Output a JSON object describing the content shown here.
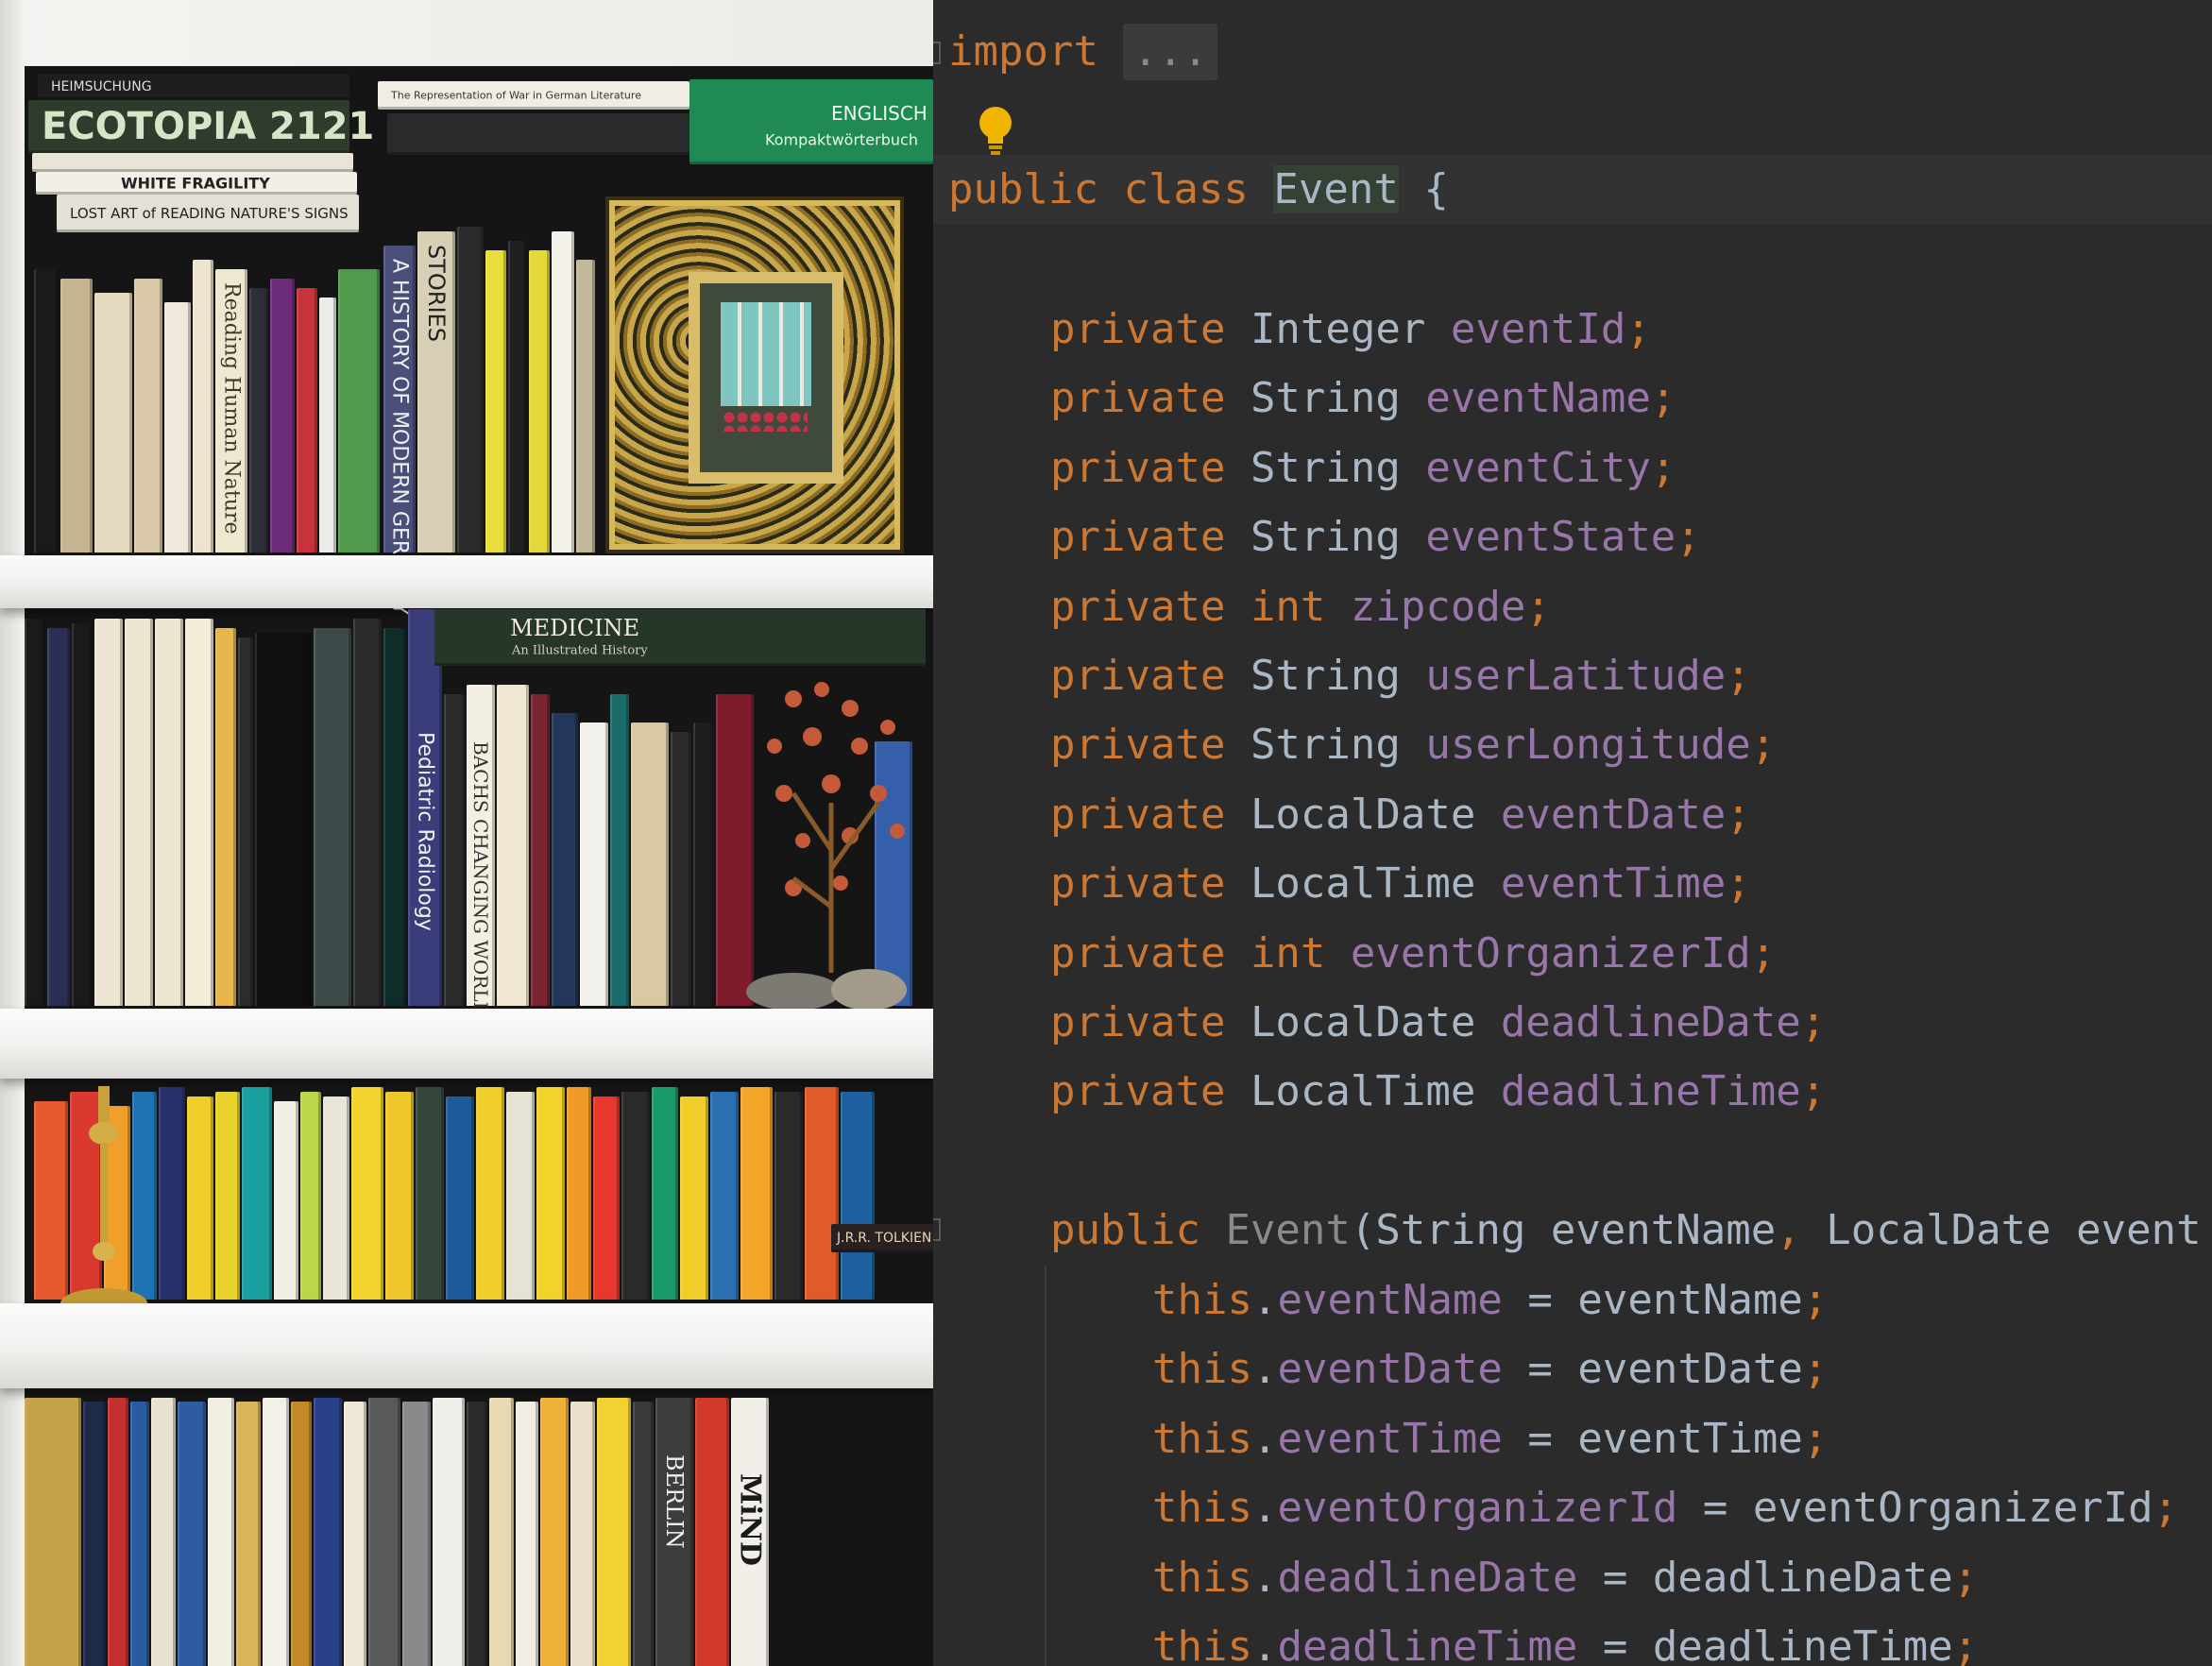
{
  "photo": {
    "book_titles": [
      "ECOTOPIA 2121",
      "WHITE FRAGILITY",
      "LOST ART of READING NATURE'S SIGNS",
      "STORIES",
      "A HISTORY OF MODERN GERMANY",
      "MEDICINE",
      "An Illustrated History",
      "Pediatric Radiology",
      "BACHS CHANGING WORLD",
      "BERLIN",
      "MiND",
      "ENGLISCH",
      "Kompaktwörterbuch",
      "HEIMSUCHUNG",
      "Reading Human Nature",
      "J.R.R. TOLKIEN",
      "The Representation of War in German Literature"
    ],
    "colors": {
      "wall": "#f4f3f0",
      "shelf": "#f1f0ee",
      "frame_gold": "#d8b95a"
    }
  },
  "editor": {
    "theme": {
      "background": "#2b2b2b",
      "keyword": "#cc7832",
      "field": "#9876aa",
      "text": "#a9b7c6",
      "ctor": "#8a8a8a",
      "bulb": "#f0b400"
    },
    "import_kw": "import",
    "import_fold": "...",
    "class_decl": {
      "kw1": "public",
      "kw2": "class",
      "name": "Event",
      "brace": "{"
    },
    "fields": [
      {
        "mod": "private",
        "type": "Integer",
        "name": "eventId",
        "primitive": false
      },
      {
        "mod": "private",
        "type": "String",
        "name": "eventName",
        "primitive": false
      },
      {
        "mod": "private",
        "type": "String",
        "name": "eventCity",
        "primitive": false
      },
      {
        "mod": "private",
        "type": "String",
        "name": "eventState",
        "primitive": false
      },
      {
        "mod": "private",
        "type": "int",
        "name": "zipcode",
        "primitive": true
      },
      {
        "mod": "private",
        "type": "String",
        "name": "userLatitude",
        "primitive": false
      },
      {
        "mod": "private",
        "type": "String",
        "name": "userLongitude",
        "primitive": false
      },
      {
        "mod": "private",
        "type": "LocalDate",
        "name": "eventDate",
        "primitive": false
      },
      {
        "mod": "private",
        "type": "LocalTime",
        "name": "eventTime",
        "primitive": false
      },
      {
        "mod": "private",
        "type": "int",
        "name": "eventOrganizerId",
        "primitive": true
      },
      {
        "mod": "private",
        "type": "LocalDate",
        "name": "deadlineDate",
        "primitive": false
      },
      {
        "mod": "private",
        "type": "LocalTime",
        "name": "deadlineTime",
        "primitive": false
      }
    ],
    "constructor": {
      "kw": "public",
      "name": "Event",
      "params": "(String eventName, LocalDate event"
    },
    "assignments": [
      {
        "this": "this",
        "field": "eventName",
        "value": "eventName"
      },
      {
        "this": "this",
        "field": "eventDate",
        "value": "eventDate"
      },
      {
        "this": "this",
        "field": "eventTime",
        "value": "eventTime"
      },
      {
        "this": "this",
        "field": "eventOrganizerId",
        "value": "eventOrganizerId"
      },
      {
        "this": "this",
        "field": "deadlineDate",
        "value": "deadlineDate"
      },
      {
        "this": "this",
        "field": "deadlineTime",
        "value": "deadlineTime"
      }
    ],
    "semicolon": ";",
    "equals": "=",
    "dot": ".",
    "comma": ","
  }
}
